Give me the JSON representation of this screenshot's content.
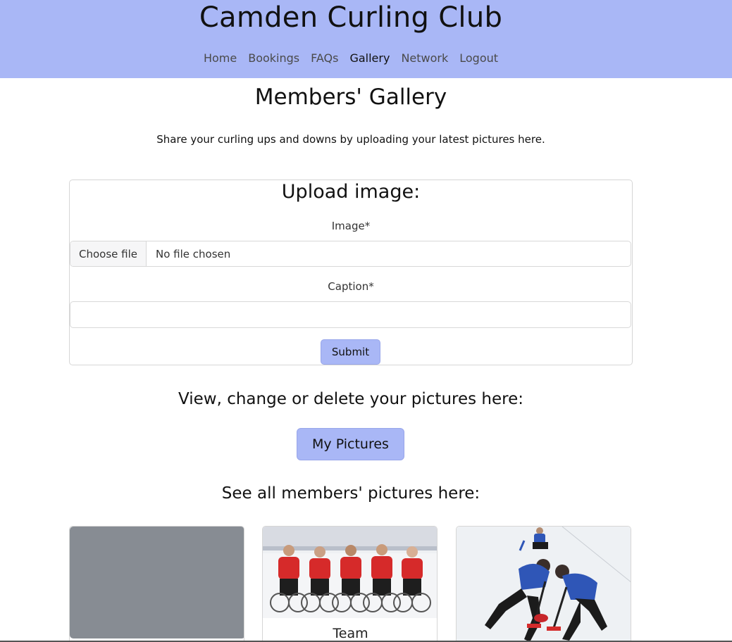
{
  "header": {
    "site_title": "Camden Curling Club",
    "nav": [
      "Home",
      "Bookings",
      "FAQs",
      "Gallery",
      "Network",
      "Logout"
    ],
    "active_nav": "Gallery",
    "background_color": "#a9b7f6"
  },
  "main": {
    "page_title": "Members' Gallery",
    "intro": "Share your curling ups and downs by uploading your latest pictures here."
  },
  "upload_form": {
    "title": "Upload image:",
    "image_label": "Image*",
    "file_button": "Choose file",
    "file_status": "No file chosen",
    "caption_label": "Caption*",
    "caption_value": "",
    "submit_label": "Submit"
  },
  "my_pictures": {
    "heading": "View, change or delete your pictures here:",
    "button_label": "My Pictures"
  },
  "gallery": {
    "heading": "See all members' pictures here:",
    "cards": [
      {
        "caption": "",
        "image": "placeholder-grey"
      },
      {
        "caption": "Team",
        "image": "wheelchair-curling-team-photo"
      },
      {
        "caption": "",
        "image": "curling-sweepers-photo"
      }
    ]
  },
  "colors": {
    "accent": "#a9b7f6",
    "placeholder": "#878c93"
  }
}
